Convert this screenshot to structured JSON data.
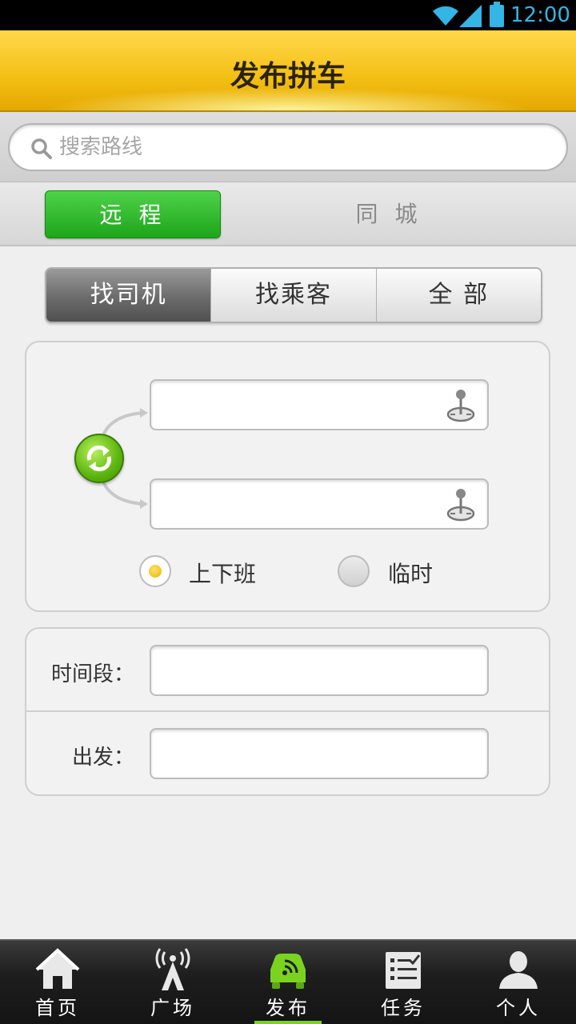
{
  "status_bar": {
    "time": "12:00"
  },
  "header": {
    "title": "发布拼车"
  },
  "search": {
    "placeholder": "搜索路线",
    "value": ""
  },
  "region_tabs": [
    {
      "label": "远 程",
      "active": true
    },
    {
      "label": "同 城",
      "active": false
    }
  ],
  "segments": [
    {
      "label": "找司机",
      "active": true
    },
    {
      "label": "找乘客",
      "active": false
    },
    {
      "label": "全  部",
      "active": false
    }
  ],
  "route": {
    "from_value": "",
    "to_value": "",
    "options": [
      {
        "label": "上下班",
        "checked": true
      },
      {
        "label": "临时",
        "checked": false
      }
    ]
  },
  "time_form": {
    "period_label": "时间段：",
    "period_value": "",
    "depart_label": "出发：",
    "depart_value": ""
  },
  "bottom_nav": [
    {
      "label": "首页",
      "icon": "home-icon",
      "active": false
    },
    {
      "label": "广场",
      "icon": "broadcast-icon",
      "active": false
    },
    {
      "label": "发布",
      "icon": "car-icon",
      "active": true
    },
    {
      "label": "任务",
      "icon": "checklist-icon",
      "active": false
    },
    {
      "label": "个人",
      "icon": "person-icon",
      "active": false
    }
  ],
  "colors": {
    "accent_green": "#7ad31e",
    "title_yellow": "#f3bf14",
    "status_blue": "#33b5e5"
  }
}
